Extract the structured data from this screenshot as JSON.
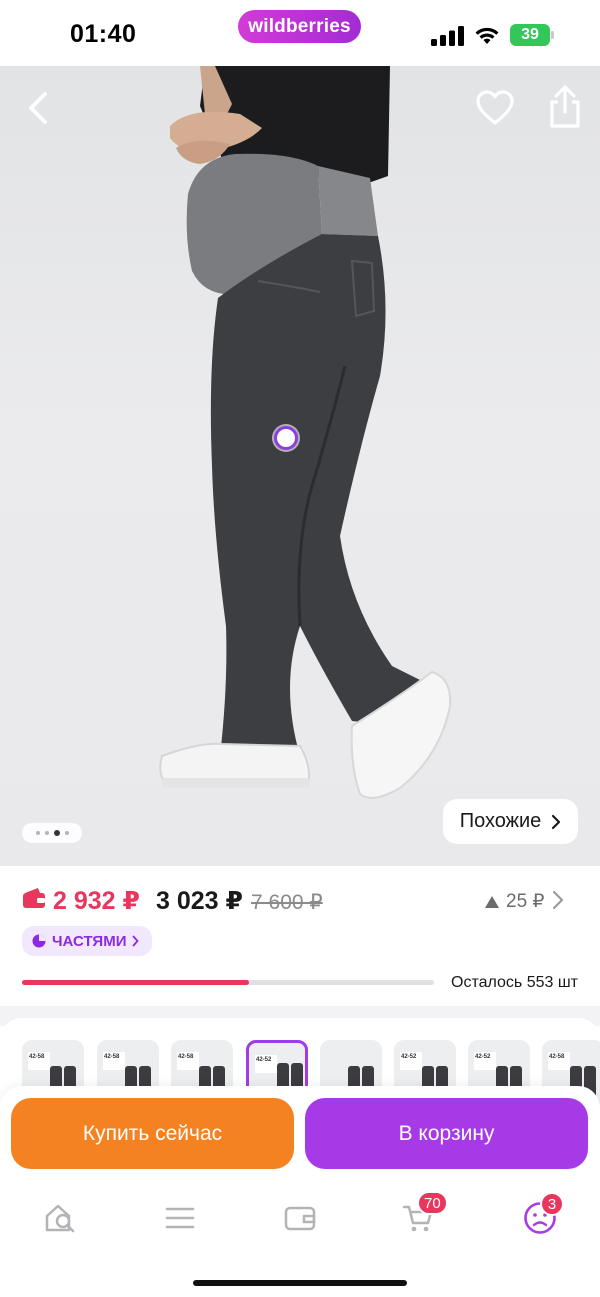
{
  "status_bar": {
    "time": "01:40",
    "brand": "wildberries",
    "battery": "39"
  },
  "hero": {
    "similar_label": "Похожие",
    "gallery_dots": 4,
    "gallery_active_index": 2
  },
  "price": {
    "wallet_price": "2 932 ₽",
    "main_price": "3 023 ₽",
    "old_price": "7 600 ₽",
    "points": "25 ₽",
    "installments_label": "ЧАСТЯМИ",
    "stock_label": "Осталось 553 шт",
    "stock_progress": 0.55
  },
  "thumbnails": [
    {
      "tag": "42-58",
      "selected": false
    },
    {
      "tag": "42-58",
      "selected": false
    },
    {
      "tag": "42-58",
      "selected": false
    },
    {
      "tag": "42-52",
      "selected": true
    },
    {
      "tag": "",
      "selected": false
    },
    {
      "tag": "42-52",
      "selected": false
    },
    {
      "tag": "42-52",
      "selected": false
    },
    {
      "tag": "42-58",
      "selected": false
    }
  ],
  "actions": {
    "buy_now": "Купить сейчас",
    "to_cart": "В корзину"
  },
  "bottom_nav": {
    "cart_badge": "70",
    "profile_badge": "3"
  },
  "colors": {
    "brand_purple": "#a73ae7",
    "buy_orange": "#f58220",
    "accent_red": "#e8365d"
  },
  "icons": [
    "back-icon",
    "heart-icon",
    "share-icon",
    "wallet-icon",
    "triangle-icon",
    "chevron-right-icon",
    "installments-icon",
    "home-search-icon",
    "menu-icon",
    "wallet-nav-icon",
    "cart-icon",
    "profile-icon"
  ]
}
